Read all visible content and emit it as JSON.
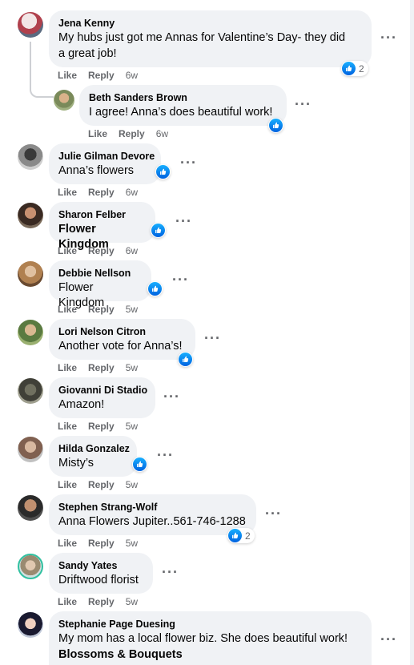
{
  "actions": {
    "like": "Like",
    "reply": "Reply"
  },
  "comments": [
    {
      "name": "Jena Kenny",
      "lines": [
        "My hubs just got me Annas for Valentine’s Day- they did",
        "a great job!"
      ],
      "time": "6w",
      "reactions": "2"
    },
    {
      "name": "Beth Sanders Brown",
      "lines": [
        "I agree! Anna’s does beautiful work!"
      ],
      "time": "6w"
    },
    {
      "name": "Julie Gilman Devore",
      "lines": [
        "Anna’s flowers"
      ],
      "time": "6w"
    },
    {
      "name": "Sharon Felber",
      "lines": [
        "Flower Kingdom"
      ],
      "time": "6w"
    },
    {
      "name": "Debbie Nellson",
      "lines": [
        "Flower Kingdom"
      ],
      "time": "5w"
    },
    {
      "name": "Lori Nelson Citron",
      "lines": [
        "Another vote for Anna’s!"
      ],
      "time": "5w"
    },
    {
      "name": "Giovanni Di Stadio",
      "lines": [
        "Amazon!"
      ],
      "time": "5w"
    },
    {
      "name": "Hilda Gonzalez",
      "lines": [
        "Misty’s"
      ],
      "time": "5w"
    },
    {
      "name": "Stephen Strang-Wolf",
      "lines": [
        "Anna Flowers Jupiter..561-746-1288"
      ],
      "time": "5w",
      "reactions": "2"
    },
    {
      "name": "Sandy Yates",
      "lines": [
        "Driftwood florist"
      ],
      "time": "5w"
    },
    {
      "name": "Stephanie Page Duesing",
      "lines": [
        "My mom has a local flower biz. She does beautiful work!",
        "Blossoms & Bouquets"
      ]
    }
  ],
  "colors": {
    "bubble": "#f0f2f5",
    "like_blue": "#1877f2",
    "meta_gray": "#65676b"
  }
}
